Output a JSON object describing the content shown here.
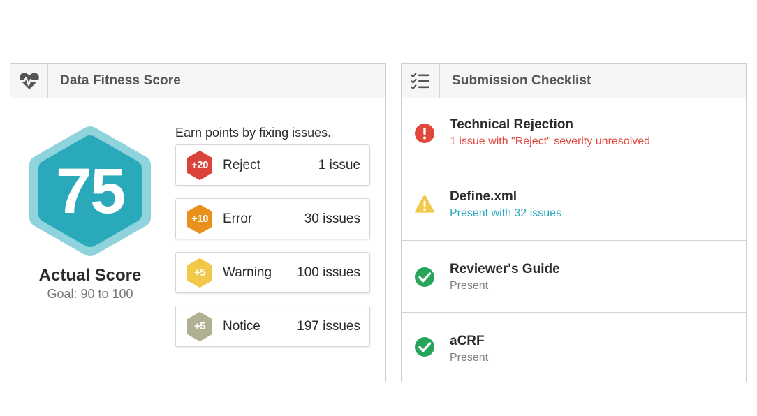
{
  "fitness": {
    "title": "Data Fitness Score",
    "icon": "heartbeat-icon",
    "score": "75",
    "score_label": "Actual Score",
    "goal": "Goal: 90 to 100",
    "earn_title": "Earn points by fixing issues.",
    "colors": {
      "hex_outer": "#8fd3dd",
      "hex_inner": "#29a9ba"
    },
    "issues": [
      {
        "points": "+20",
        "name": "Reject",
        "count": "1 issue",
        "color": "#d9433a"
      },
      {
        "points": "+10",
        "name": "Error",
        "count": "30 issues",
        "color": "#e8911d"
      },
      {
        "points": "+5",
        "name": "Warning",
        "count": "100 issues",
        "color": "#f1c84a"
      },
      {
        "points": "+5",
        "name": "Notice",
        "count": "197 issues",
        "color": "#b1b092"
      }
    ]
  },
  "checklist": {
    "title": "Submission Checklist",
    "icon": "checklist-icon",
    "items": [
      {
        "title": "Technical Rejection",
        "subtitle": "1 issue with \"Reject\" severity unresolved",
        "status": "error",
        "subtitle_color": "#e0483e"
      },
      {
        "title": "Define.xml",
        "subtitle": "Present with 32 issues",
        "status": "warning",
        "subtitle_color": "#2aa9c0"
      },
      {
        "title": "Reviewer's Guide",
        "subtitle": "Present",
        "status": "ok",
        "subtitle_color": "#808080"
      },
      {
        "title": "aCRF",
        "subtitle": "Present",
        "status": "ok",
        "subtitle_color": "#808080"
      }
    ]
  }
}
